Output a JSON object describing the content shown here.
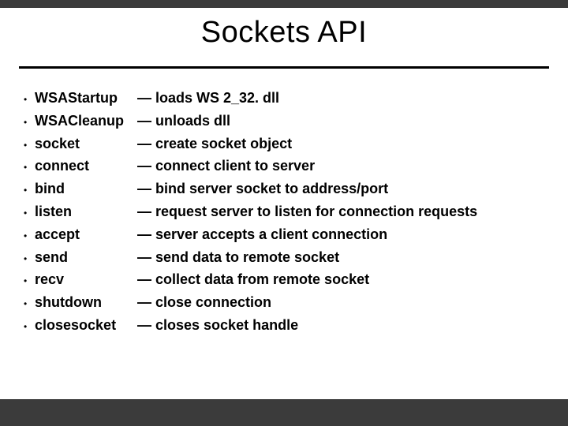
{
  "title": "Sockets API",
  "items": [
    {
      "fn": "WSAStartup",
      "desc": "— loads WS 2_32. dll"
    },
    {
      "fn": "WSACleanup",
      "desc": "— unloads dll"
    },
    {
      "fn": "socket",
      "desc": "— create socket object"
    },
    {
      "fn": "connect",
      "desc": "— connect client to server"
    },
    {
      "fn": "bind",
      "desc": "— bind server socket to address/port"
    },
    {
      "fn": "listen",
      "desc": "— request server to listen for connection requests"
    },
    {
      "fn": "accept",
      "desc": "— server accepts a client connection"
    },
    {
      "fn": "send",
      "desc": "— send data to remote socket"
    },
    {
      "fn": "recv",
      "desc": "— collect data from remote socket"
    },
    {
      "fn": "shutdown",
      "desc": "— close connection"
    },
    {
      "fn": "closesocket",
      "desc": "— closes socket handle"
    }
  ]
}
